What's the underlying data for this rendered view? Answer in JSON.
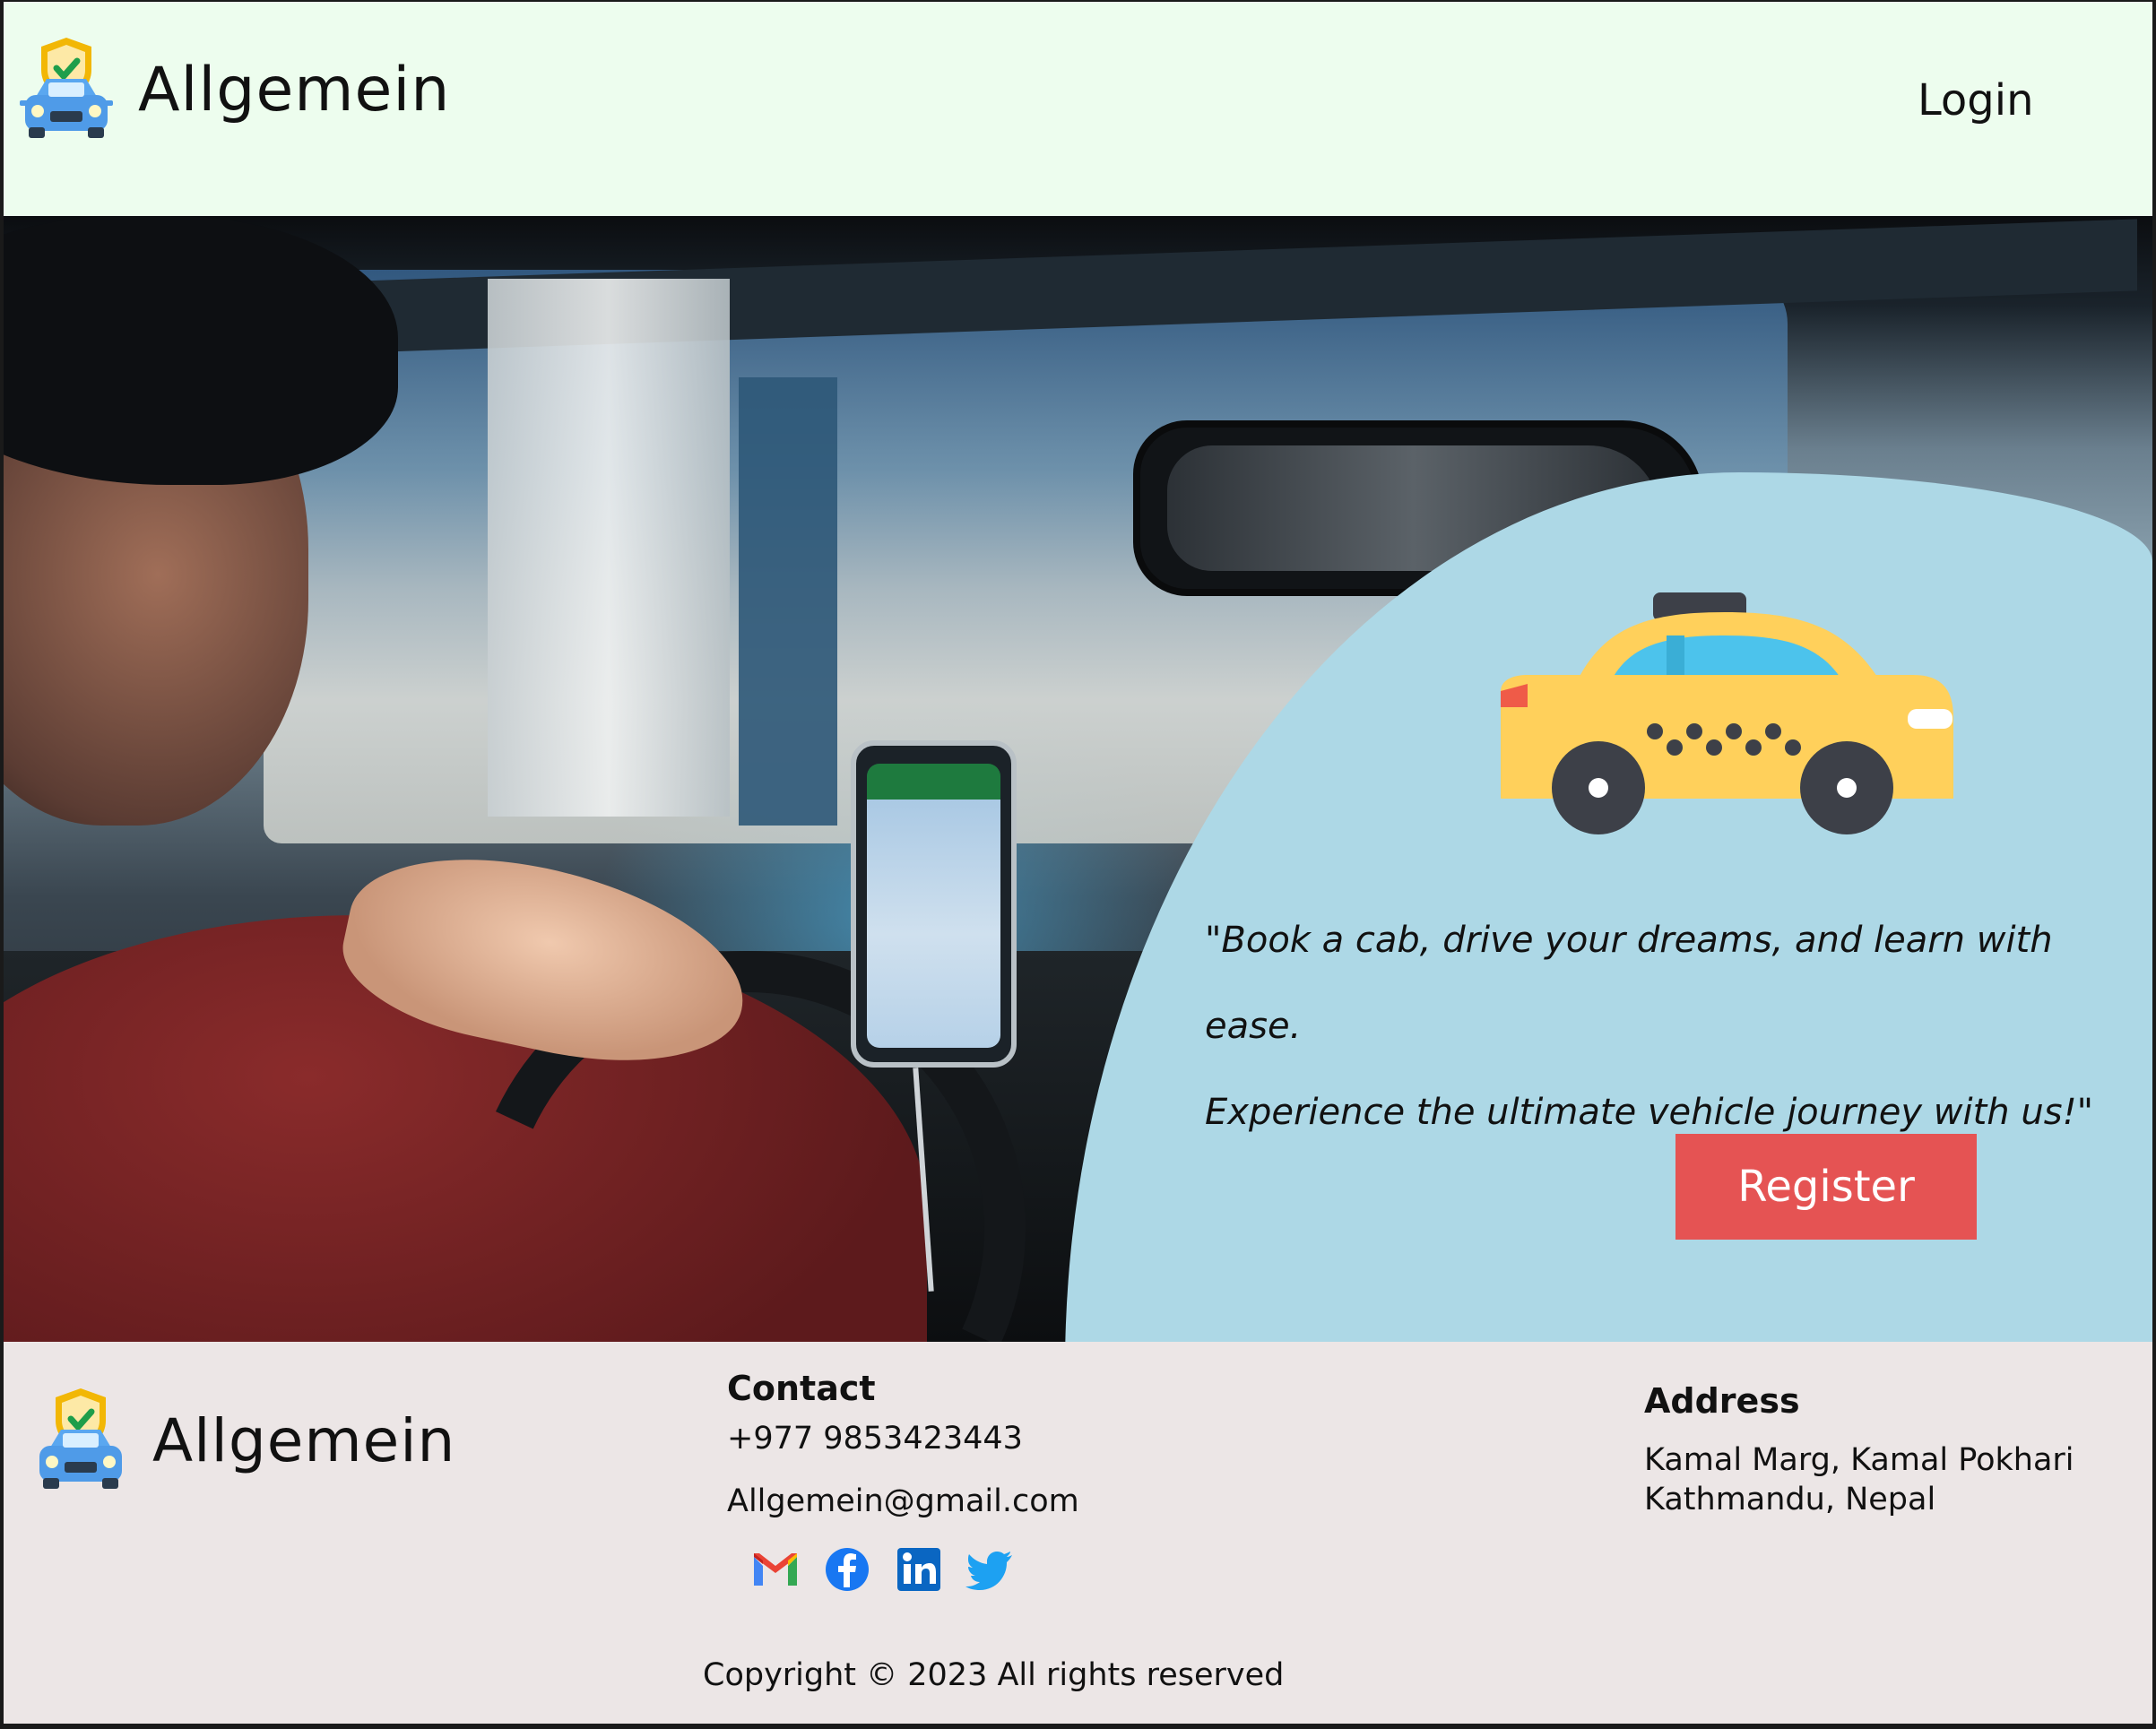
{
  "header": {
    "brand_name": "Allgemein",
    "logo_icon": "car-shield-icon",
    "login_label": "Login",
    "background": "#edfdee"
  },
  "hero": {
    "image_icon": "driver-taxi-photo",
    "card_background": "#add8e6",
    "taxi_icon": "taxi-icon",
    "quote_line1": "\"Book a cab, drive your dreams, and learn with ease.",
    "quote_line2": "Experience the ultimate vehicle journey with us!\"",
    "register_label": "Register",
    "register_color": "#e55353"
  },
  "footer": {
    "brand_name": "Allgemein",
    "logo_icon": "car-shield-icon",
    "contact": {
      "heading": "Contact",
      "phone": "+977 9853423443",
      "email": "Allgemein@gmail.com",
      "socials": [
        "gmail-icon",
        "facebook-icon",
        "linkedin-icon",
        "twitter-icon"
      ]
    },
    "address": {
      "heading": "Address",
      "line1": "Kamal Marg, Kamal Pokhari",
      "line2": "Kathmandu, Nepal"
    },
    "copyright": "Copyright © 2023 All rights reserved",
    "background": "#ece6e6"
  }
}
